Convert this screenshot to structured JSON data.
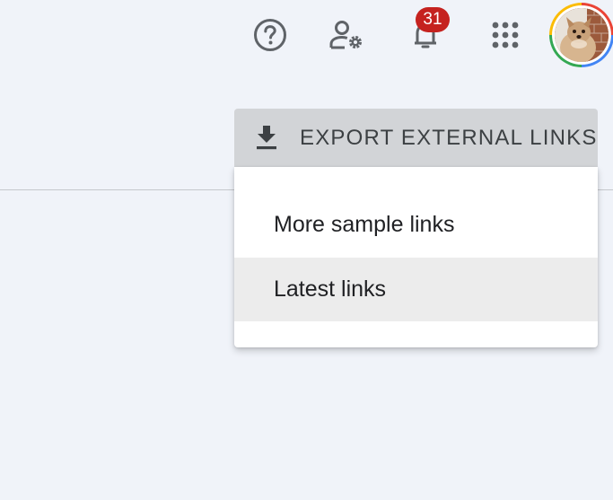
{
  "header": {
    "icons": {
      "help": "help-circle-icon",
      "admin": "admin-settings-icon",
      "notifications": "bell-icon",
      "apps": "apps-grid-icon"
    },
    "notifications_count": "31"
  },
  "export": {
    "button_label": "EXPORT EXTERNAL LINKS",
    "icon": "download-icon",
    "menu_items": [
      {
        "label": "More sample links"
      },
      {
        "label": "Latest links",
        "hovered": true
      }
    ]
  },
  "colors": {
    "background": "#f0f3f9",
    "badge": "#c5221f",
    "button": "#d2d4d7",
    "menu_hover": "#ececec"
  }
}
